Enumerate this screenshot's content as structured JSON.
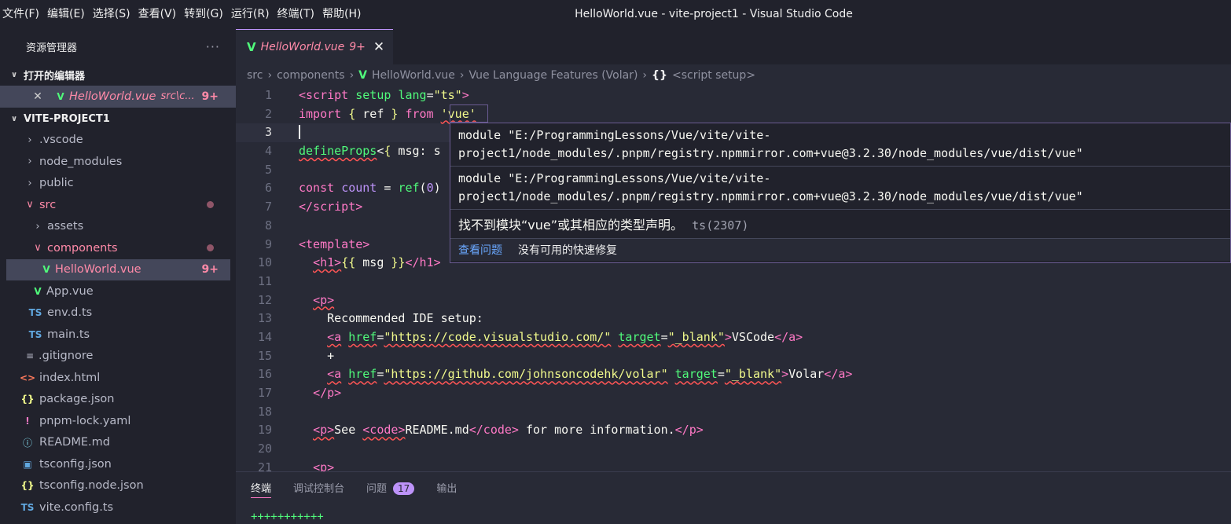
{
  "menu": [
    "文件(F)",
    "编辑(E)",
    "选择(S)",
    "查看(V)",
    "转到(G)",
    "运行(R)",
    "终端(T)",
    "帮助(H)"
  ],
  "window_title": "HelloWorld.vue - vite-project1 - Visual Studio Code",
  "sidebar": {
    "title": "资源管理器",
    "more": "···",
    "open_editors_label": "打开的编辑器",
    "open_editor": {
      "name": "HelloWorld.vue",
      "path": "src\\c...",
      "badge": "9+"
    },
    "project_label": "VITE-PROJECT1",
    "tree": [
      {
        "name": ".vscode"
      },
      {
        "name": "node_modules"
      },
      {
        "name": "public"
      },
      {
        "name": "src"
      },
      {
        "name": "assets"
      },
      {
        "name": "components"
      },
      {
        "name": "HelloWorld.vue",
        "badge": "9+"
      },
      {
        "name": "App.vue"
      },
      {
        "name": "env.d.ts"
      },
      {
        "name": "main.ts"
      },
      {
        "name": ".gitignore"
      },
      {
        "name": "index.html"
      },
      {
        "name": "package.json"
      },
      {
        "name": "pnpm-lock.yaml"
      },
      {
        "name": "README.md"
      },
      {
        "name": "tsconfig.json"
      },
      {
        "name": "tsconfig.node.json"
      },
      {
        "name": "vite.config.ts"
      }
    ],
    "icons": {
      "ts": "TS",
      "html": "<>",
      "json": "{}",
      "yaml": "!",
      "git": "≡"
    }
  },
  "tab": {
    "name": "HelloWorld.vue",
    "badge": "9+",
    "close": "✕"
  },
  "breadcrumb": [
    "src",
    "components",
    "HelloWorld.vue",
    "Vue Language Features (Volar)",
    "<script setup>"
  ],
  "breadcrumb_brace": "{}",
  "line_numbers": [
    "1",
    "2",
    "3",
    "4",
    "5",
    "6",
    "7",
    "8",
    "9",
    "10",
    "11",
    "12",
    "13",
    "14",
    "15",
    "16",
    "17",
    "18",
    "19",
    "20",
    "21"
  ],
  "hover": {
    "module1_line1": "module \"E:/ProgrammingLessons/Vue/vite/vite-",
    "module1_line2": "project1/node_modules/.pnpm/registry.npmmirror.com+vue@3.2.30/node_modules/vue/dist/vue\"",
    "module2_line1": "module \"E:/ProgrammingLessons/Vue/vite/vite-",
    "module2_line2": "project1/node_modules/.pnpm/registry.npmmirror.com+vue@3.2.30/node_modules/vue/dist/vue\"",
    "error": "找不到模块“vue”或其相应的类型声明。",
    "error_code": "ts(2307)",
    "view_problem": "查看问题",
    "no_fix": "没有可用的快速修复"
  },
  "panel": {
    "tabs": [
      "终端",
      "调试控制台",
      "问题",
      "输出"
    ],
    "problem_count": "17",
    "terminal_line": "+++++++++++"
  }
}
